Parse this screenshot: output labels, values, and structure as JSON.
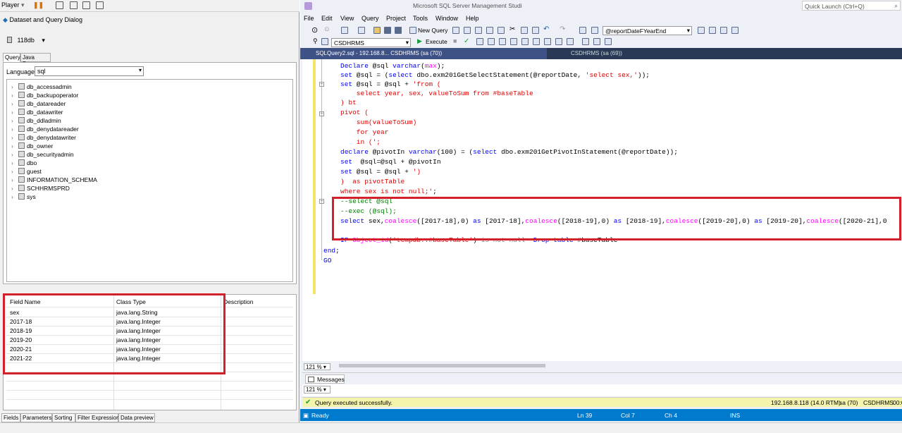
{
  "left": {
    "player_label": "Player",
    "dialog_title": "Dataset and Query Dialog",
    "db_name": "118db",
    "tabs": [
      "Query",
      "Java Bean"
    ],
    "language_label": "Language",
    "language_value": "sql",
    "tree_items": [
      "db_accessadmin",
      "db_backupoperator",
      "db_datareader",
      "db_datawriter",
      "db_ddladmin",
      "db_denydatareader",
      "db_denydatawriter",
      "db_owner",
      "db_securityadmin",
      "dbo",
      "guest",
      "INFORMATION_SCHEMA",
      "SCHHRMSPRD",
      "sys"
    ],
    "fields_headers": [
      "Field Name",
      "Class Type",
      "Description"
    ],
    "fields_rows": [
      [
        "sex",
        "java.lang.String"
      ],
      [
        "2017-18",
        "java.lang.Integer"
      ],
      [
        "2018-19",
        "java.lang.Integer"
      ],
      [
        "2019-20",
        "java.lang.Integer"
      ],
      [
        "2020-21",
        "java.lang.Integer"
      ],
      [
        "2021-22",
        "java.lang.Integer"
      ]
    ],
    "bottom_tabs": [
      "Fields",
      "Parameters",
      "Sorting",
      "Filter Expression",
      "Data preview"
    ]
  },
  "ssms": {
    "title": "Microsoft SQL Server Management Studi",
    "quick_launch": "Quick Launch (Ctrl+Q)",
    "menus": [
      "File",
      "Edit",
      "View",
      "Query",
      "Project",
      "Tools",
      "Window",
      "Help"
    ],
    "new_query": "New Query",
    "param_combo": "@reportDateFYearEnd",
    "db_combo": "CSDHRMS",
    "execute": "Execute",
    "doc_tab": "SQLQuery2.sql - 192.168.8... CSDHRMS (sa (70))",
    "doc_tab2": "CSDHRMS (sa (69))",
    "zoom": "121 %",
    "messages_tab": "Messages",
    "exec_status": "Query executed successfully.",
    "server": "192.168.8.118 (14.0 RTM)",
    "user": "sa (70)",
    "db": "CSDHRMS",
    "time": "00:0",
    "status_ready": "Ready",
    "ln": "Ln 39",
    "col": "Col 7",
    "ch": "Ch 4",
    "ins": "INS"
  }
}
